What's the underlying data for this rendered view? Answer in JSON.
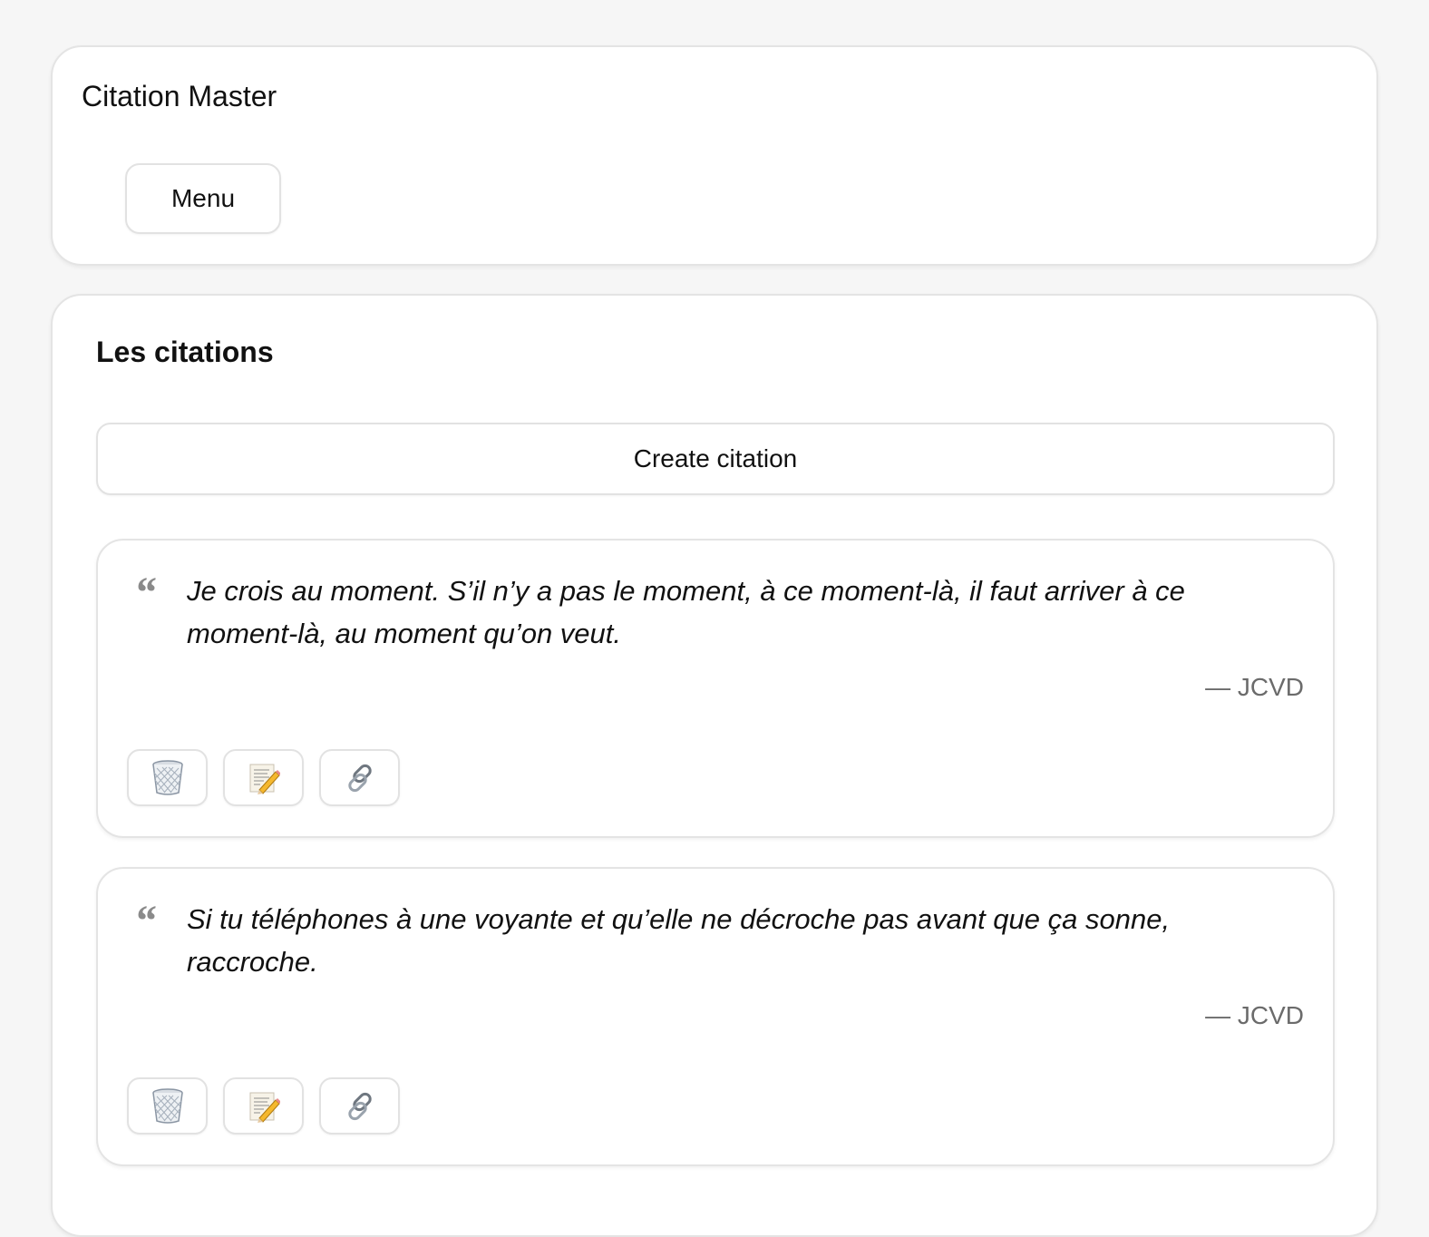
{
  "header": {
    "app_title": "Citation Master",
    "menu_label": "Menu"
  },
  "main": {
    "section_title": "Les citations",
    "create_label": "Create citation",
    "quote_mark": "“",
    "citations": [
      {
        "text": "Je crois au moment. S’il n’y a pas le moment, à ce moment-là, il faut arriver à ce moment-là, au moment qu’on veut.",
        "author": "— JCVD",
        "actions": [
          "trash-icon",
          "edit-memo-icon",
          "link-icon"
        ]
      },
      {
        "text": "Si tu téléphones à une voyante et qu’elle ne décroche pas avant que ça sonne, raccroche.",
        "author": "— JCVD",
        "actions": [
          "trash-icon",
          "edit-memo-icon",
          "link-icon"
        ]
      }
    ]
  }
}
